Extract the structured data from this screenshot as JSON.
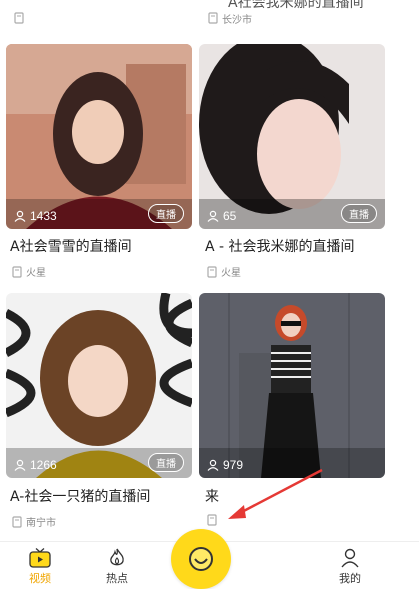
{
  "top_partial": {
    "left_loc": "",
    "right_loc": "长沙市",
    "right_title_fragment": "A社会我米娜的直播间"
  },
  "cards": [
    {
      "viewers": "1433",
      "live_label": "直播",
      "title": "A社会雪雪的直播间",
      "location": "火星"
    },
    {
      "viewers": "65",
      "live_label": "直播",
      "title": "A - 社会我米娜的直播间",
      "location": "火星"
    },
    {
      "viewers": "1266",
      "live_label": "直播",
      "title": "A-社会一只猪的直播间",
      "location": "南宁市"
    },
    {
      "viewers": "979",
      "live_label": "",
      "title": "来",
      "location": ""
    }
  ],
  "tabbar": {
    "video_label": "视频",
    "hot_label": "热点",
    "mine_label": "我的"
  },
  "colors": {
    "accent": "#ffd91a",
    "active_tab": "#f0a500",
    "arrow": "#e53935"
  }
}
